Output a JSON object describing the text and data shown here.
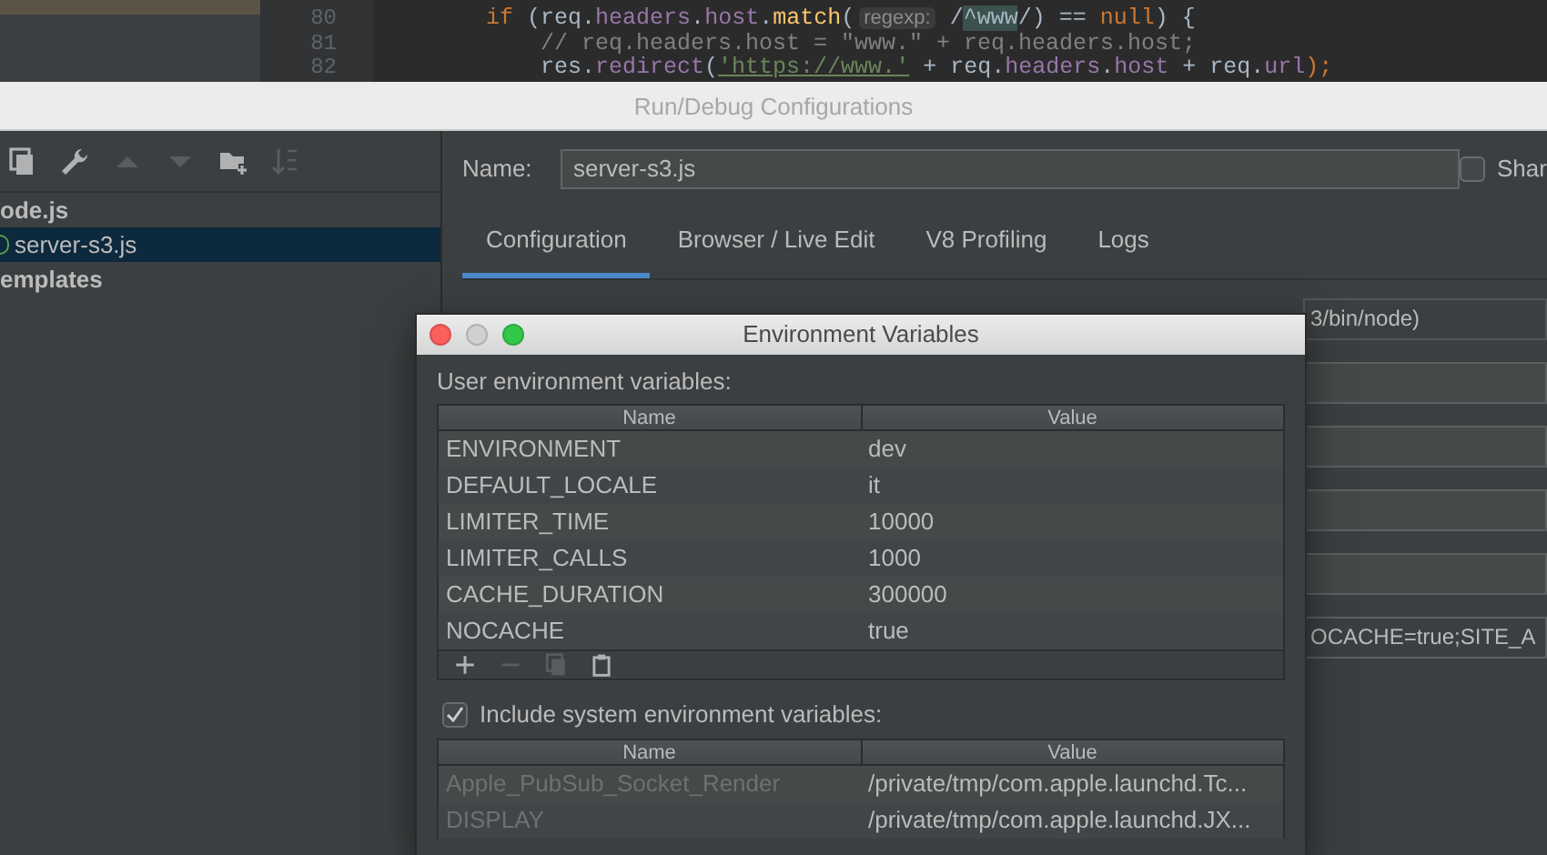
{
  "editor": {
    "lines": [
      {
        "number": "80",
        "tokens": [
          {
            "kind": "keyword",
            "text": "if"
          },
          {
            "kind": "plain",
            "text": " (req."
          },
          {
            "kind": "field",
            "text": "headers"
          },
          {
            "kind": "plain",
            "text": "."
          },
          {
            "kind": "field",
            "text": "host"
          },
          {
            "kind": "plain",
            "text": "."
          },
          {
            "kind": "method",
            "text": "match"
          },
          {
            "kind": "plain",
            "text": "("
          },
          {
            "kind": "hint",
            "text": "regexp:"
          },
          {
            "kind": "plain",
            "text": " /"
          },
          {
            "kind": "regex",
            "text": "^www"
          },
          {
            "kind": "plain",
            "text": "/) == "
          },
          {
            "kind": "keyword",
            "text": "null"
          },
          {
            "kind": "plain",
            "text": ") {"
          }
        ]
      },
      {
        "number": "81",
        "tokens": [
          {
            "kind": "comment",
            "text": "    // req.headers.host = \"www.\" + req.headers.host;"
          }
        ]
      },
      {
        "number": "82",
        "tokens": [
          {
            "kind": "plain",
            "text": "    res."
          },
          {
            "kind": "field",
            "text": "redirect"
          },
          {
            "kind": "plain",
            "text": "("
          },
          {
            "kind": "string",
            "text": "'https://www.'"
          },
          {
            "kind": "plain",
            "text": " + req."
          },
          {
            "kind": "field",
            "text": "headers"
          },
          {
            "kind": "plain",
            "text": "."
          },
          {
            "kind": "field",
            "text": "host"
          },
          {
            "kind": "plain",
            "text": " + req."
          },
          {
            "kind": "field",
            "text": "url"
          },
          {
            "kind": "keyword",
            "text": ");"
          }
        ]
      }
    ]
  },
  "window": {
    "title": "Run/Debug Configurations"
  },
  "toolbar": [
    {
      "kind": "copy",
      "disabled": false
    },
    {
      "kind": "wrench",
      "disabled": false
    },
    {
      "kind": "up",
      "disabled": true
    },
    {
      "kind": "down",
      "disabled": true
    },
    {
      "kind": "folder",
      "disabled": false
    },
    {
      "kind": "sort",
      "disabled": true
    }
  ],
  "tree": [
    {
      "label": "ode.js",
      "kind": "group",
      "selected": false
    },
    {
      "label": "server-s3.js",
      "kind": "config",
      "selected": true
    },
    {
      "label": "emplates",
      "kind": "group",
      "selected": false
    }
  ],
  "name": {
    "label": "Name:",
    "value": "server-s3.js"
  },
  "share": {
    "label": "Shar",
    "checked": false
  },
  "tabs": [
    {
      "label": "Configuration",
      "selected": true
    },
    {
      "label": "Browser / Live Edit",
      "selected": false
    },
    {
      "label": "V8 Profiling",
      "selected": false
    },
    {
      "label": "Logs",
      "selected": false
    }
  ],
  "fields": [
    {
      "kind": "interpreter",
      "value": "3/bin/node)"
    },
    {
      "kind": "blank"
    },
    {
      "kind": "blank"
    },
    {
      "kind": "blank"
    },
    {
      "kind": "blank"
    },
    {
      "kind": "env",
      "value": "OCACHE=true;SITE_A"
    }
  ],
  "env_dialog": {
    "title": "Environment Variables",
    "user_label": "User environment variables:",
    "columns": [
      "Name",
      "Value"
    ],
    "user_rows": [
      {
        "name": "ENVIRONMENT",
        "value": "dev"
      },
      {
        "name": "DEFAULT_LOCALE",
        "value": "it"
      },
      {
        "name": "LIMITER_TIME",
        "value": "10000"
      },
      {
        "name": "LIMITER_CALLS",
        "value": "1000"
      },
      {
        "name": "CACHE_DURATION",
        "value": "300000"
      },
      {
        "name": "NOCACHE",
        "value": "true"
      }
    ],
    "actions": [
      {
        "kind": "add",
        "disabled": false
      },
      {
        "kind": "remove",
        "disabled": true
      },
      {
        "kind": "copy",
        "disabled": true
      },
      {
        "kind": "paste",
        "disabled": false
      }
    ],
    "include_system": {
      "label": "Include system environment variables:",
      "checked": true
    },
    "system_columns": [
      "Name",
      "Value"
    ],
    "system_rows": [
      {
        "name": "Apple_PubSub_Socket_Render",
        "value": "/private/tmp/com.apple.launchd.Tc..."
      },
      {
        "name": "DISPLAY",
        "value": "/private/tmp/com.apple.launchd.JX..."
      }
    ]
  }
}
